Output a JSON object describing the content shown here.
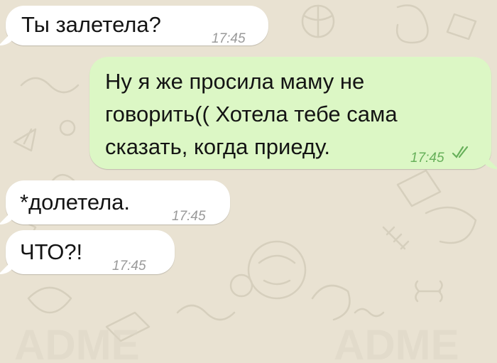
{
  "messages": [
    {
      "direction": "incoming",
      "text": "Ты залетела?",
      "time": "17:45"
    },
    {
      "direction": "outgoing",
      "lines": [
        "Ну я же просила маму не",
        "говорить(( Хотела тебе сама",
        "сказать, когда приеду."
      ],
      "time": "17:45",
      "status_icon": "double-check-icon"
    },
    {
      "direction": "incoming",
      "text": "*долетела.",
      "time": "17:45"
    },
    {
      "direction": "incoming",
      "text": "ЧТО?!",
      "time": "17:45"
    }
  ],
  "colors": {
    "background": "#e9e2d2",
    "incoming_bubble": "#ffffff",
    "outgoing_bubble": "#dcf7c5",
    "outgoing_time": "#67b05a"
  }
}
